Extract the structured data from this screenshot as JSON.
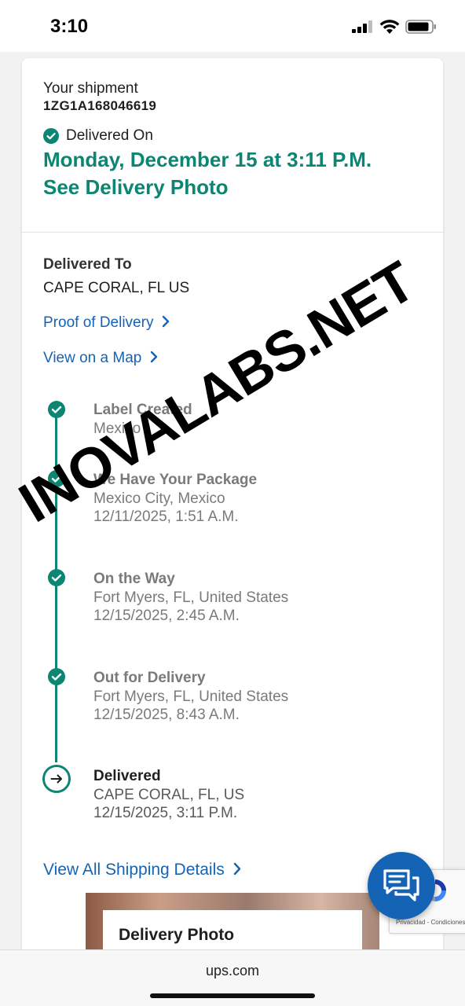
{
  "status_bar": {
    "time": "3:10"
  },
  "shipment": {
    "label": "Your shipment",
    "tracking_number": "1ZG1A168046619",
    "status_label": "Delivered On",
    "delivered_date": "Monday, December 15 at 3:11 P.M.",
    "photo_link": "See Delivery Photo"
  },
  "delivery": {
    "to_label": "Delivered To",
    "to_value": "CAPE CORAL, FL US",
    "proof_link": "Proof of Delivery",
    "map_link": "View on a Map"
  },
  "timeline": [
    {
      "title": "Label Created",
      "location": "Mexico",
      "datetime": ""
    },
    {
      "title": "We Have Your Package",
      "location": "Mexico City, Mexico",
      "datetime": "12/11/2025, 1:51 A.M."
    },
    {
      "title": "On the Way",
      "location": "Fort Myers, FL, United States",
      "datetime": "12/15/2025, 2:45 A.M."
    },
    {
      "title": "Out for Delivery",
      "location": "Fort Myers, FL, United States",
      "datetime": "12/15/2025, 8:43 A.M."
    },
    {
      "title": "Delivered",
      "location": "CAPE CORAL, FL, US",
      "datetime": "12/15/2025, 3:11 P.M."
    }
  ],
  "all_details_link": "View All Shipping Details",
  "photo_section_title": "Delivery Photo",
  "watermark": "INOVALABS.NET",
  "recaptcha_text": "Privacidad - Condiciones",
  "browser": {
    "url": "ups.com"
  },
  "colors": {
    "brand_teal": "#0d8573",
    "link_blue": "#1563b5",
    "chat_blue": "#1563b5"
  }
}
